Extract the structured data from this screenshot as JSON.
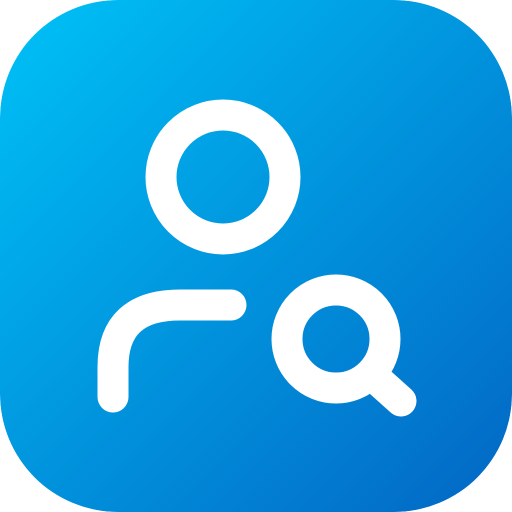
{
  "icon": {
    "name": "user-search-icon",
    "background": {
      "gradient_start": "#00C2F7",
      "gradient_end": "#0266C4"
    },
    "glyph_color": "#FFFFFF"
  }
}
